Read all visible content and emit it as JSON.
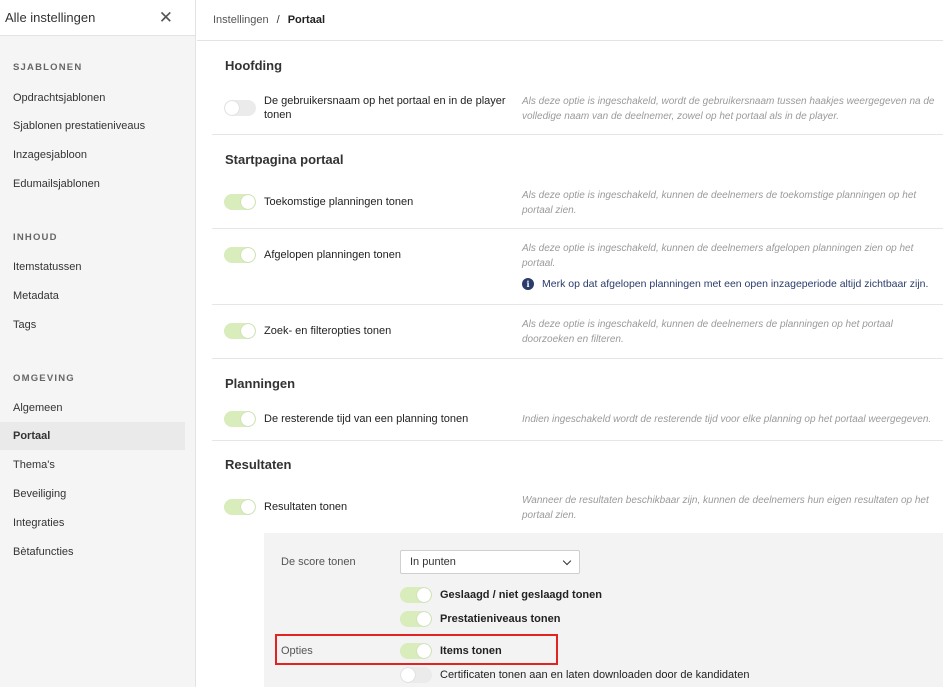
{
  "sidebar": {
    "title": "Alle instellingen",
    "sections": [
      {
        "label": "SJABLONEN",
        "items": [
          "Opdrachtsjablonen",
          "Sjablonen prestatieniveaus",
          "Inzagesjabloon",
          "Edumailsjablonen"
        ]
      },
      {
        "label": "INHOUD",
        "items": [
          "Itemstatussen",
          "Metadata",
          "Tags"
        ]
      },
      {
        "label": "OMGEVING",
        "items": [
          "Algemeen",
          "Portaal",
          "Thema's",
          "Beveiliging",
          "Integraties",
          "Bètafuncties"
        ]
      }
    ],
    "active_item": "Portaal"
  },
  "breadcrumb": {
    "parent": "Instellingen",
    "separator": "/",
    "current": "Portaal"
  },
  "sections": {
    "hoofding": {
      "title": "Hoofding",
      "rows": [
        {
          "label_line1": "De gebruikersnaam op het portaal en in de player",
          "label_line2": "tonen",
          "enabled": false,
          "desc_line1": "Als deze optie is ingeschakeld, wordt de gebruikersnaam tussen haakjes weergegeven na de",
          "desc_line2": "volledige naam van de deelnemer, zowel op het portaal als in de player."
        }
      ]
    },
    "startpagina": {
      "title": "Startpagina portaal",
      "rows": [
        {
          "label": "Toekomstige planningen tonen",
          "enabled": true,
          "desc_line1": "Als deze optie is ingeschakeld, kunnen de deelnemers de toekomstige planningen op het",
          "desc_line2": "portaal zien."
        },
        {
          "label": "Afgelopen planningen tonen",
          "enabled": true,
          "desc_line1": "Als deze optie is ingeschakeld, kunnen de deelnemers afgelopen planningen zien op het",
          "desc_line2": "portaal.",
          "info": "Merk op dat afgelopen planningen met een open inzageperiode altijd zichtbaar zijn."
        },
        {
          "label": "Zoek- en filteropties tonen",
          "enabled": true,
          "desc_line1": "Als deze optie is ingeschakeld, kunnen de deelnemers de planningen op het portaal",
          "desc_line2": "doorzoeken en filteren."
        }
      ]
    },
    "planningen": {
      "title": "Planningen",
      "rows": [
        {
          "label": "De resterende tijd van een planning tonen",
          "enabled": true,
          "desc_line1": "Indien ingeschakeld wordt de resterende tijd voor elke planning op het portaal weergegeven."
        }
      ]
    },
    "resultaten": {
      "title": "Resultaten",
      "rows": [
        {
          "label": "Resultaten tonen",
          "enabled": true,
          "desc_line1": "Wanneer de resultaten beschikbaar zijn, kunnen de deelnemers hun eigen resultaten op het",
          "desc_line2": "portaal zien."
        }
      ],
      "panel": {
        "score_label": "De score tonen",
        "score_select_value": "In punten",
        "options_label": "Opties",
        "toggles": [
          {
            "label": "Geslaagd / niet geslaagd tonen",
            "enabled": true
          },
          {
            "label": "Prestatieniveaus tonen",
            "enabled": true
          },
          {
            "label": "Items tonen",
            "enabled": true
          },
          {
            "label": "Certificaten tonen aan en laten downloaden door de kandidaten",
            "enabled": false
          }
        ]
      }
    }
  },
  "colors": {
    "toggle_on": "#d8ecbc",
    "toggle_off": "#ebebeb",
    "highlight_box": "#e32222",
    "info_icon": "#2b3c6b"
  }
}
